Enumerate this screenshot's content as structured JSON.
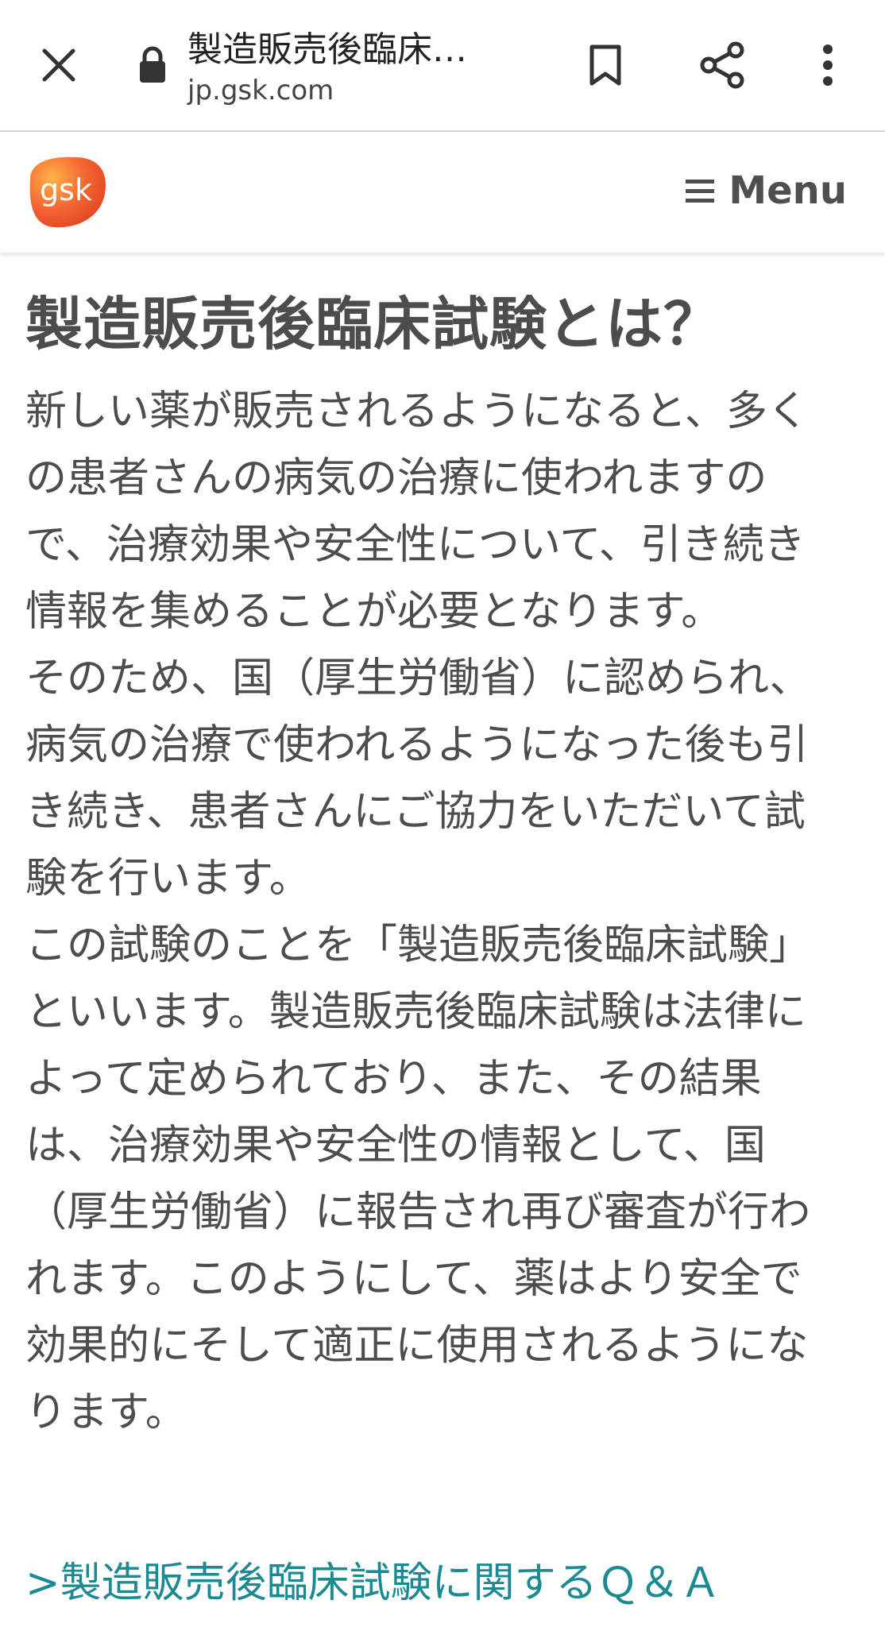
{
  "browser": {
    "tab_title": "製造販売後臨床…",
    "url": "jp.gsk.com"
  },
  "header": {
    "logo_text": "gsk",
    "menu_label": "Menu"
  },
  "main": {
    "title": "製造販売後臨床試験とは？",
    "paragraphs": [
      "新しい薬が販売されるようになると、多くの患者さんの病気の治療に使われますので、治療効果や安全性について、引き続き情報を集めることが必要となります。",
      "そのため、国（厚生労働省）に認められ、病気の治療で使われるようになった後も引き続き、患者さんにご協力をいただいて試験を行います。",
      "この試験のことを「製造販売後臨床試験」といいます。製造販売後臨床試験は法律によって定められており、また、その結果は、治療効果や安全性の情報として、国（厚生労働省）に報告され再び審査が行われます。このようにして、薬はより安全で効果的にそして適正に使用されるようになります。"
    ],
    "qa_link": ">製造販売後臨床試験に関するＱ＆Ａ"
  },
  "icons": [
    "close-icon",
    "lock-icon",
    "bookmark-icon",
    "share-icon",
    "more-vert-icon",
    "hamburger-icon"
  ],
  "colors": {
    "logo_orange": "#f36633",
    "text_gray": "#4d4d4d",
    "link_teal": "#1b8a93"
  }
}
